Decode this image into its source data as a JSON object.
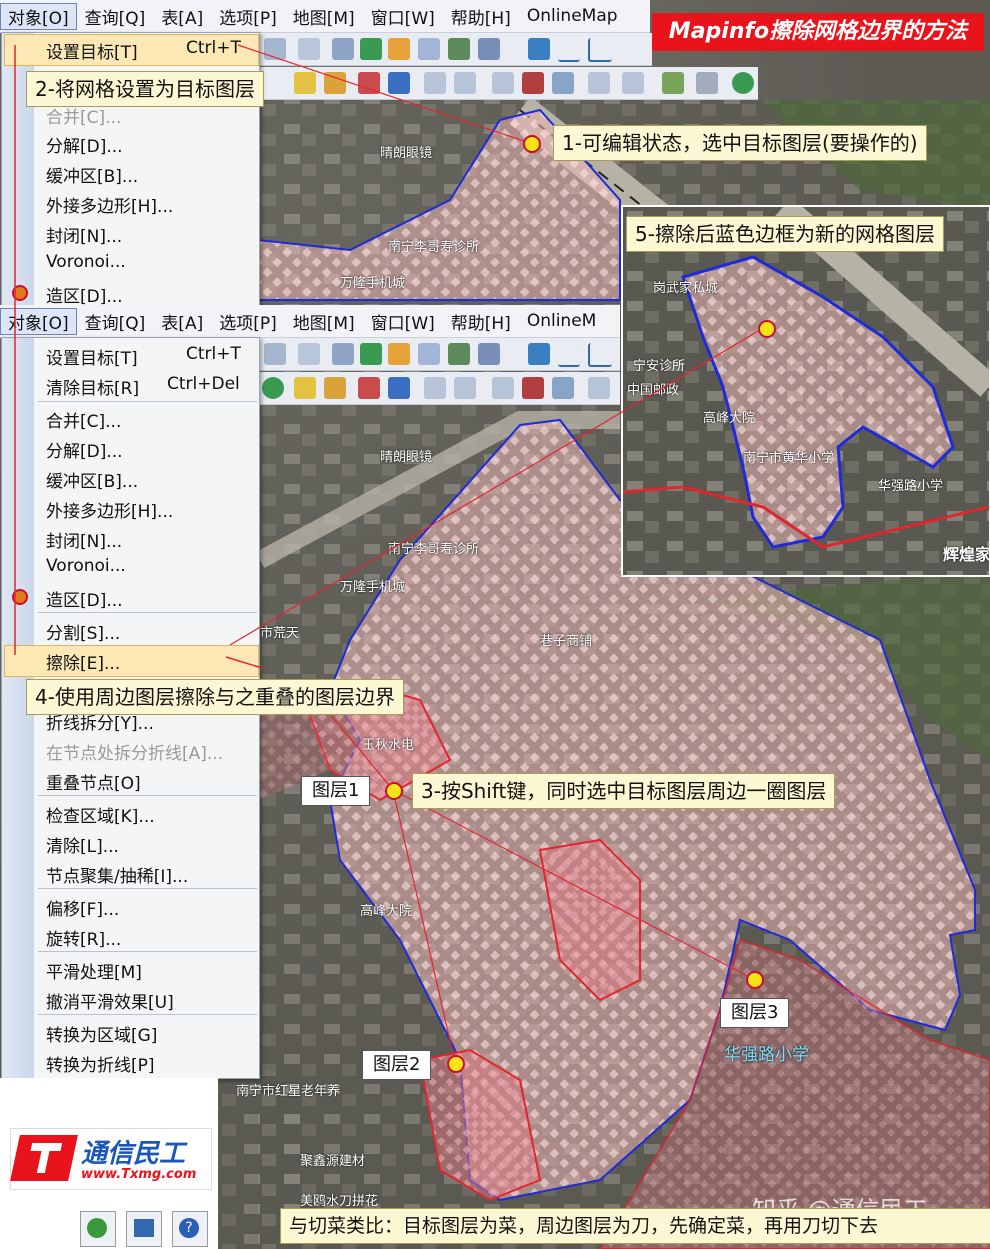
{
  "title": "Mapinfo擦除网格边界的方法",
  "menubar_top": [
    "对象[O]",
    "查询[Q]",
    "表[A]",
    "选项[P]",
    "地图[M]",
    "窗口[W]",
    "帮助[H]",
    "OnlineMap"
  ],
  "menubar_mid": [
    "对象[O]",
    "查询[Q]",
    "表[A]",
    "选项[P]",
    "地图[M]",
    "窗口[W]",
    "帮助[H]",
    "OnlineM"
  ],
  "menu_top": {
    "set_target": "设置目标[T]",
    "set_target_sc": "Ctrl+T",
    "merge": "合并[C]...",
    "items": [
      "分解[D]...",
      "缓冲区[B]...",
      "外接多边形[H]...",
      "封闭[N]...",
      "Voronoi...",
      "造区[D]..."
    ]
  },
  "menu_main": {
    "set_target": "设置目标[T]",
    "set_target_sc": "Ctrl+T",
    "clear_target": "清除目标[R]",
    "clear_target_sc": "Ctrl+Del",
    "merge": "合并[C]...",
    "split": "分解[D]...",
    "buffer": "缓冲区[B]...",
    "hull": "外接多边形[H]...",
    "close": "封闭[N]...",
    "voronoi": "Voronoi...",
    "make_region": "造区[D]...",
    "divide": "分割[S]...",
    "erase": "擦除[E]...",
    "polyline_split": "折线拆分[Y]...",
    "node_split": "在节点处拆分折线[A]...",
    "overlap_nodes": "重叠节点[O]",
    "check_regions": "检查区域[K]...",
    "clean": "清除[L]...",
    "node_cluster": "节点聚集/抽稀[I]...",
    "offset": "偏移[F]...",
    "rotate": "旋转[R]...",
    "smooth": "平滑处理[M]",
    "unsmooth": "撤消平滑效果[U]",
    "to_region": "转换为区域[G]",
    "to_polyline": "转换为折线[P]"
  },
  "callouts": {
    "c1": "1-可编辑状态，选中目标图层(要操作的)",
    "c2": "2-将网格设置为目标图层",
    "c3": "3-按Shift键，同时选中目标图层周边一圈图层",
    "c4": "4-使用周边图层擦除与之重叠的图层边界",
    "c5": "5-擦除后蓝色边框为新的网格图层"
  },
  "layer_labels": {
    "l1": "图层1",
    "l2": "图层2",
    "l3": "图层3"
  },
  "places": [
    "晴朗眼镜",
    "南宁李哥寿诊所",
    "万隆手机城",
    "市荒天",
    "巷子商铺",
    "华强路小学",
    "高峰大院",
    "玉秋水电",
    "岗武家私城",
    "宁安诊所",
    "中国邮政",
    "辉煌家",
    "南宁市黄华小学",
    "华强路小学",
    "聚鑫源建材",
    "美鸥水刀拼花",
    "南宁市红星老年养"
  ],
  "logo": {
    "brand": "通信民工",
    "url": "www.Txmg.com"
  },
  "footer": "与切菜类比：目标图层为菜，周边图层为刀，先确定菜，再用刀切下去",
  "watermark": "知乎 @通信民工",
  "colors": {
    "title_bg": "#e8131b",
    "callout_bg": "#fdf8d4",
    "grid_border": "#1f2bd8",
    "erase_border": "#e2262e",
    "menu_highlight": "#fbe8b5"
  }
}
